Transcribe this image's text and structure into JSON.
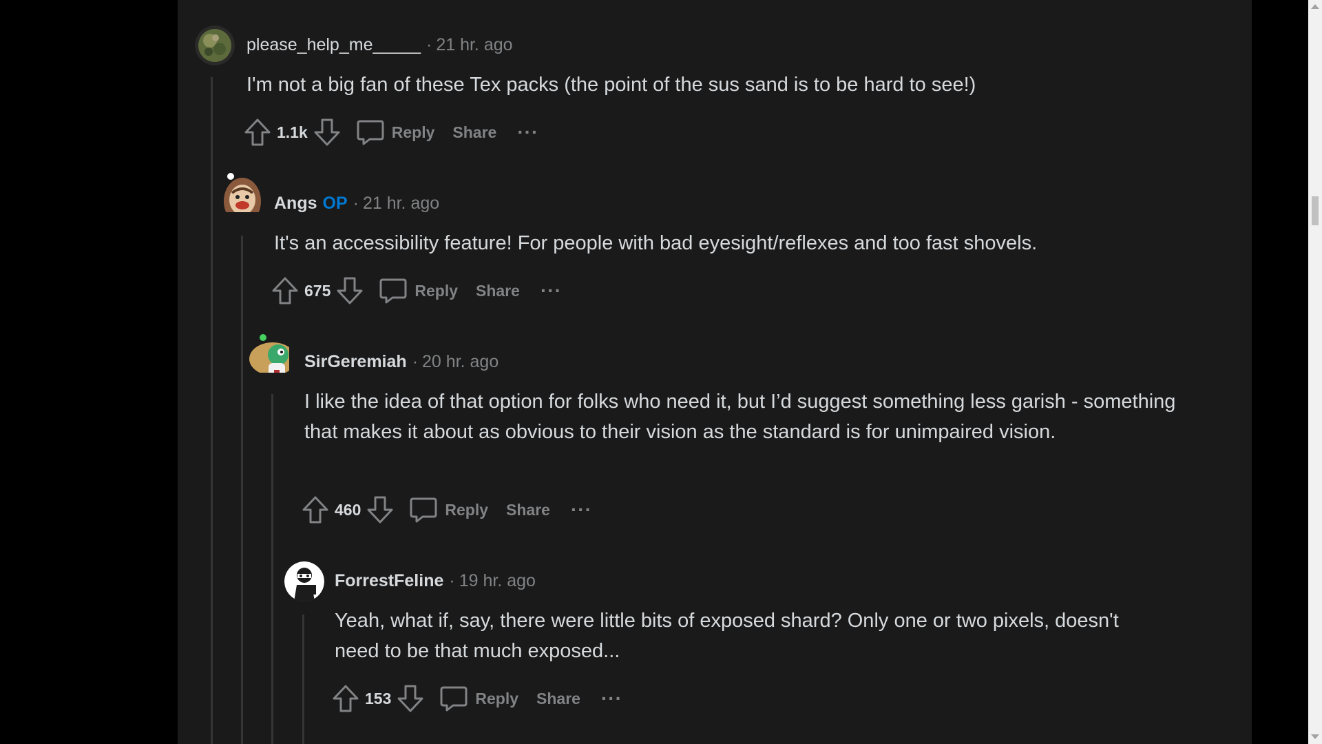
{
  "colors": {
    "background": "#1a1a1b",
    "text": "#d7dadc",
    "muted": "#818384",
    "op_badge": "#0079d3",
    "thread_line": "#343536"
  },
  "comments": [
    {
      "username": "please_help_me_____",
      "time": "21 hr. ago",
      "body": "I'm not a big fan of these Tex packs (the point of the sus sand is to be hard to see!)",
      "score": "1.1k",
      "reply_label": "Reply",
      "share_label": "Share",
      "more_label": "···"
    },
    {
      "username": "Angs",
      "op_badge": "OP",
      "time": "21 hr. ago",
      "body": "It's an accessibility feature! For people with bad eyesight/reflexes and too fast shovels.",
      "score": "675",
      "reply_label": "Reply",
      "share_label": "Share",
      "more_label": "···"
    },
    {
      "username": "SirGeremiah",
      "time": "20 hr. ago",
      "body": "I like the idea of that option for folks who need it, but I’d suggest something less garish - something that makes it about as obvious to their vision as the standard is for unimpaired vision.",
      "score": "460",
      "reply_label": "Reply",
      "share_label": "Share",
      "more_label": "···"
    },
    {
      "username": "ForrestFeline",
      "time": "19 hr. ago",
      "body": "Yeah, what if, say, there were little bits of exposed shard? Only one or two pixels, doesn't need to be that much exposed...",
      "score": "153",
      "reply_label": "Reply",
      "share_label": "Share",
      "more_label": "···"
    }
  ],
  "separator": "·"
}
